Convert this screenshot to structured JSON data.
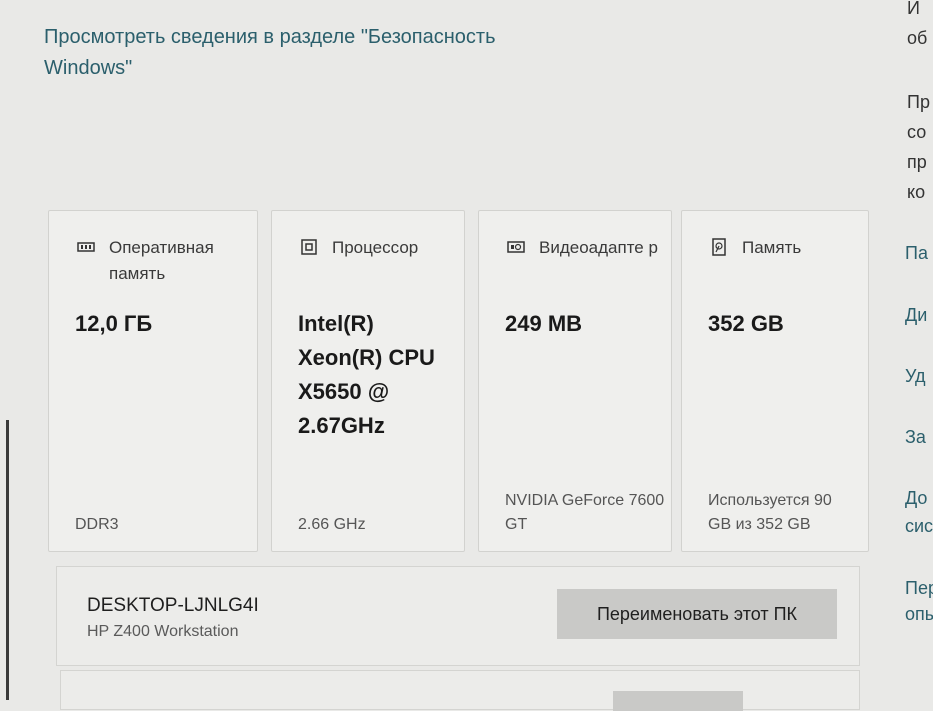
{
  "security_link": "Просмотреть сведения в разделе \"Безопасность Windows\"",
  "specs": [
    {
      "icon": "ram-icon",
      "title": "Оперативная память",
      "value": "12,0 ГБ",
      "sub": "DDR3"
    },
    {
      "icon": "processor-icon",
      "title": "Процессор",
      "value": "Intel(R) Xeon(R) CPU X5650 @ 2.67GHz",
      "sub": "2.66 GHz"
    },
    {
      "icon": "video-adapter-icon",
      "title": "Видеоадапте р",
      "value": "249 MB",
      "sub": "NVIDIA GeForce 7600 GT"
    },
    {
      "icon": "storage-icon",
      "title": "Память",
      "value": "352 GB",
      "sub": "Используется 90 GB из 352 GB"
    }
  ],
  "device": {
    "name": "DESKTOP-LJNLG4I",
    "model": "HP Z400 Workstation",
    "rename_label": "Переименовать этот ПК"
  },
  "right_panel": {
    "text_lines": [
      "И",
      "об",
      "Пр",
      "со",
      "пр",
      "ко"
    ],
    "links": [
      "Па",
      "Ди",
      "Уд",
      "За",
      "До",
      "сис",
      "Пер",
      "опы"
    ]
  }
}
